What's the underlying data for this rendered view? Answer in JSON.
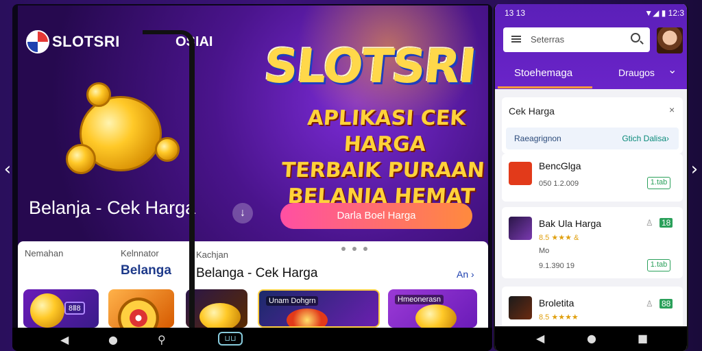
{
  "page_arrows": {
    "left": "‹",
    "right": "›"
  },
  "left_device": {
    "brand_name": "SLOTSRI",
    "brand_partial": "OSIAI",
    "big_title": "SLOTSRI",
    "tagline": [
      "APLIKASI CEK HARGA",
      "TERBAIK PURAAN",
      "BELANJA HEMAT"
    ],
    "hero_subtitle": "Belanja - Cek Harga",
    "round_button": "↓",
    "cta_label": "Darla Boel Harga",
    "content": {
      "tab_left": "Nemahan",
      "tab_mid": "Kelnnator",
      "tab_right": "Kachjan",
      "belanga": "Belanga",
      "title": "Belanga - Cek Harga",
      "more": "An ›",
      "thumb_badge": "8Ⅱ8",
      "thumb4_label": "Unam Dohgrn",
      "thumb5_label": "Hmeonerasn"
    },
    "navbar": {
      "back": "◀",
      "home": "●",
      "search": "⚲",
      "chip": "⊔⊔"
    }
  },
  "right_device": {
    "status": {
      "time_left": "13 13",
      "time_right": "12:3",
      "icons": "▼◢ ▮"
    },
    "search_placeholder": "Seterras",
    "tab_active": "Stoehemaga",
    "tab_other": "Draugos",
    "tab_chevron": "⌄",
    "panel": {
      "title": "Cek Harga",
      "close": "×",
      "row_left": "Raeagrignon",
      "row_right": "Gtich Dalisa›"
    },
    "items": [
      {
        "name": "BencGlga",
        "sub": "050 1.2.009",
        "chip": "1.tab"
      },
      {
        "name": "Bak Ula Harga",
        "stars": "8.5 ★★★ &",
        "sub2": "Mo",
        "sub": "9.1.390 19",
        "chip": "1.tab",
        "grn": "18"
      },
      {
        "name": "Broletita",
        "stars": "8.5 ★★★★",
        "grn": "88"
      }
    ],
    "navbar": {
      "back": "◀",
      "home": "●",
      "recent": "■"
    }
  }
}
